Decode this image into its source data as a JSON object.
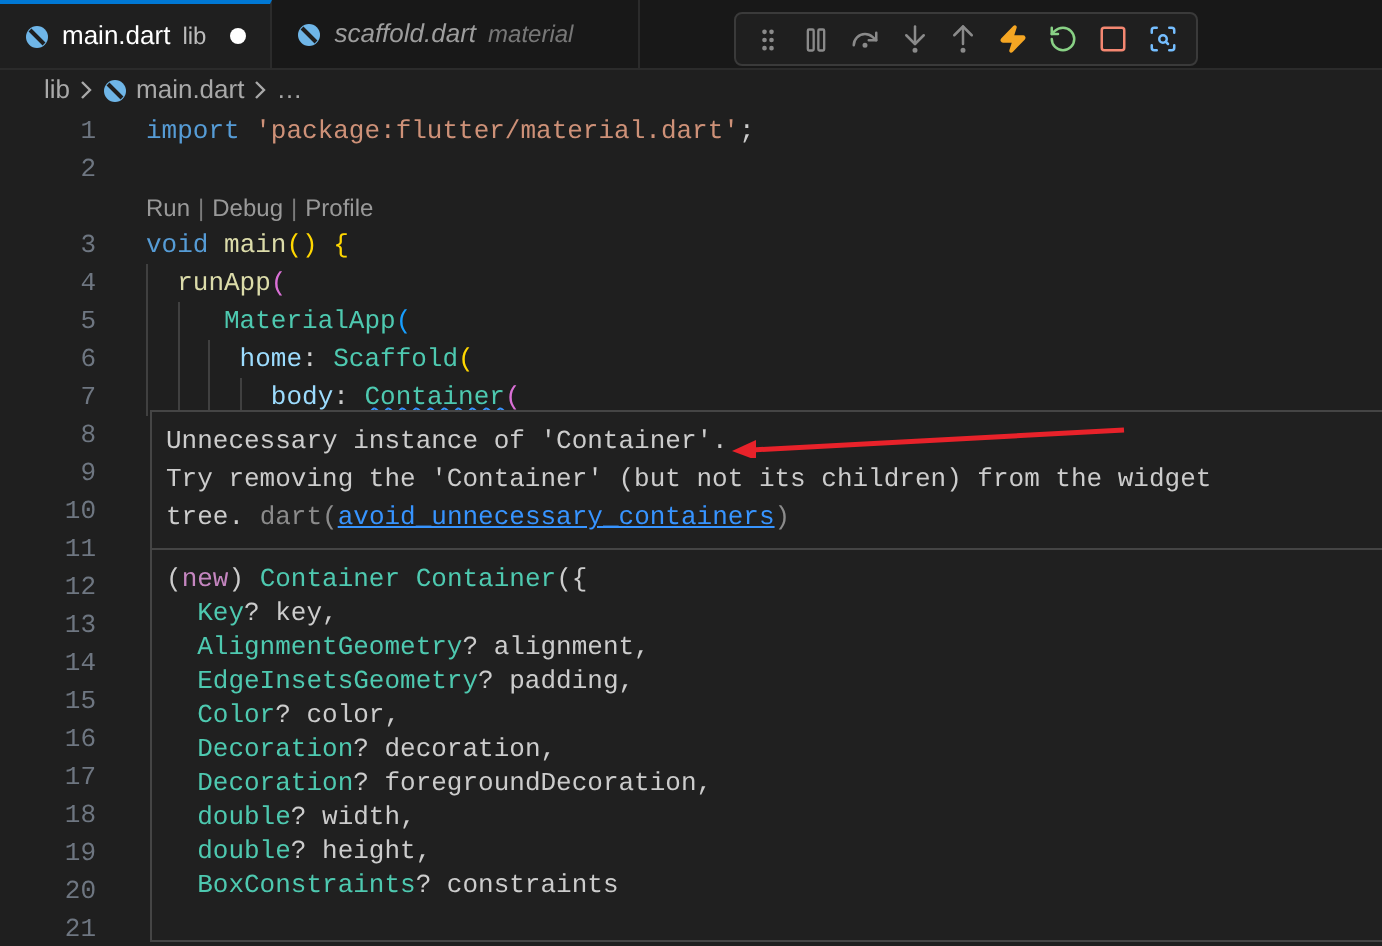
{
  "tabs": [
    {
      "label": "main.dart",
      "description": "lib",
      "selected": true,
      "modified": true,
      "preview": false
    },
    {
      "label": "scaffold.dart",
      "description": "material",
      "selected": false,
      "modified": false,
      "preview": true
    }
  ],
  "breadcrumb": [
    "lib",
    "main.dart",
    "…"
  ],
  "editor": {
    "lines": [
      {
        "number": "1",
        "tokens": [
          {
            "text": "import ",
            "kind": "keyword"
          },
          {
            "text": "'package:flutter/material.dart'",
            "kind": "string"
          },
          {
            "text": ";",
            "kind": "plain"
          }
        ]
      },
      {
        "number": "2"
      },
      {
        "kind": "codelens",
        "items": [
          {
            "text": "Run",
            "kind": "link"
          },
          {
            "text": "|",
            "kind": "separator"
          },
          {
            "text": "Debug",
            "kind": "link"
          },
          {
            "text": "|",
            "kind": "separator"
          },
          {
            "text": "Profile",
            "kind": "link"
          }
        ]
      },
      {
        "number": "3",
        "tokens": [
          {
            "text": "void ",
            "kind": "keyword"
          },
          {
            "text": "main",
            "kind": "function"
          },
          {
            "text": "() ",
            "kind": "bracket1"
          },
          {
            "text": "{",
            "kind": "bracket1"
          }
        ]
      },
      {
        "number": "4",
        "tokens": [
          {
            "text": "  runApp",
            "kind": "function"
          },
          {
            "text": "(",
            "kind": "bracket2"
          }
        ]
      },
      {
        "number": "5",
        "tokens": [
          {
            "text": "     MaterialApp",
            "kind": "type"
          },
          {
            "text": "(",
            "kind": "bracket3"
          }
        ]
      },
      {
        "number": "6",
        "tokens": [
          {
            "text": "      home",
            "kind": "property"
          },
          {
            "text": ": ",
            "kind": "plain"
          },
          {
            "text": "Scaffold",
            "kind": "type"
          },
          {
            "text": "(",
            "kind": "bracket1"
          }
        ]
      },
      {
        "number": "7",
        "tokens": [
          {
            "text": "        body",
            "kind": "property"
          },
          {
            "text": ": ",
            "kind": "plain"
          },
          {
            "text": "Container",
            "kind": "type",
            "squiggle": true
          },
          {
            "text": "(",
            "kind": "bracket2"
          }
        ]
      },
      {
        "number": "8"
      },
      {
        "number": "9"
      },
      {
        "number": "10"
      },
      {
        "number": "11"
      },
      {
        "number": "12"
      },
      {
        "number": "13"
      },
      {
        "number": "14"
      },
      {
        "number": "15"
      },
      {
        "number": "16"
      },
      {
        "number": "17"
      },
      {
        "number": "18"
      },
      {
        "number": "19"
      },
      {
        "number": "20"
      },
      {
        "number": "21"
      }
    ]
  },
  "hover": {
    "title": "Unnecessary instance of 'Container'.",
    "detail": "Try removing the 'Container' (but not its children) from the widget tree.",
    "source": "dart(",
    "code": "avoid_unnecessary_containers",
    "source_end": ")",
    "signature": [
      [
        {
          "text": "(",
          "kind": "plain"
        },
        {
          "text": "new",
          "kind": "new"
        },
        {
          "text": ") ",
          "kind": "plain"
        },
        {
          "text": "Container Container",
          "kind": "type"
        },
        {
          "text": "({",
          "kind": "plain"
        }
      ],
      [
        {
          "text": "  Key",
          "kind": "type"
        },
        {
          "text": "? key,",
          "kind": "plain"
        }
      ],
      [
        {
          "text": "  AlignmentGeometry",
          "kind": "type"
        },
        {
          "text": "? alignment,",
          "kind": "plain"
        }
      ],
      [
        {
          "text": "  EdgeInsetsGeometry",
          "kind": "type"
        },
        {
          "text": "? padding,",
          "kind": "plain"
        }
      ],
      [
        {
          "text": "  Color",
          "kind": "type"
        },
        {
          "text": "? color,",
          "kind": "plain"
        }
      ],
      [
        {
          "text": "  Decoration",
          "kind": "type"
        },
        {
          "text": "? decoration,",
          "kind": "plain"
        }
      ],
      [
        {
          "text": "  Decoration",
          "kind": "type"
        },
        {
          "text": "? foregroundDecoration,",
          "kind": "plain"
        }
      ],
      [
        {
          "text": "  double",
          "kind": "type"
        },
        {
          "text": "? width,",
          "kind": "plain"
        }
      ],
      [
        {
          "text": "  double",
          "kind": "type"
        },
        {
          "text": "? height,",
          "kind": "plain"
        }
      ],
      [
        {
          "text": "  BoxConstraints",
          "kind": "type"
        },
        {
          "text": "? constraints",
          "kind": "plain"
        }
      ]
    ]
  }
}
